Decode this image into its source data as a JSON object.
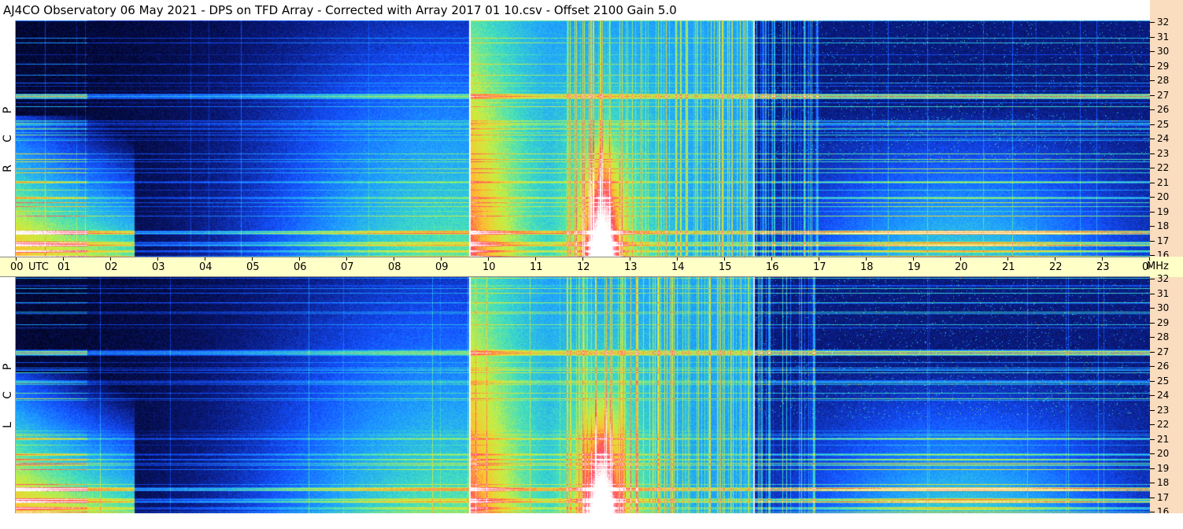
{
  "title": "AJ4CO Observatory  06 May 2021  -  DPS on TFD Array  -  Corrected with Array 2017 01 10.csv  -  Offset 2100  Gain 5.0",
  "chart_data": [
    {
      "type": "heatmap",
      "panel": "top",
      "polarization_label": [
        "R",
        "C",
        "P"
      ],
      "x_axis": {
        "unit": "UTC",
        "tick_labels": [
          "00",
          "01",
          "02",
          "03",
          "04",
          "05",
          "06",
          "07",
          "08",
          "09",
          "10",
          "11",
          "12",
          "13",
          "14",
          "15",
          "16",
          "17",
          "18",
          "19",
          "20",
          "21",
          "22",
          "23",
          "00"
        ],
        "range_hours": [
          0,
          24
        ]
      },
      "y_axis": {
        "unit": "MHz",
        "tick_labels": [
          "32",
          "31",
          "30",
          "29",
          "28",
          "27",
          "26",
          "25",
          "24",
          "23",
          "22",
          "21",
          "20",
          "19",
          "18",
          "17",
          "16"
        ],
        "range_mhz": [
          16,
          32
        ]
      },
      "colormap": [
        "#000010",
        "#0a1a80",
        "#1450ff",
        "#1ea0ff",
        "#40e0c0",
        "#c8f040",
        "#ffc030",
        "#ff4060",
        "#ffffff"
      ]
    },
    {
      "type": "heatmap",
      "panel": "bottom",
      "polarization_label": [
        "L",
        "C",
        "P"
      ],
      "x_axis": {
        "unit": "UTC",
        "range_hours": [
          0,
          24
        ]
      },
      "y_axis": {
        "unit": "MHz",
        "tick_labels": [
          "32",
          "31",
          "30",
          "29",
          "28",
          "27",
          "26",
          "25",
          "24",
          "23",
          "22",
          "21",
          "20",
          "19",
          "18",
          "17",
          "16"
        ],
        "range_mhz": [
          16,
          32
        ]
      }
    }
  ],
  "utc_unit": "UTC",
  "mhz_unit": "MHz"
}
